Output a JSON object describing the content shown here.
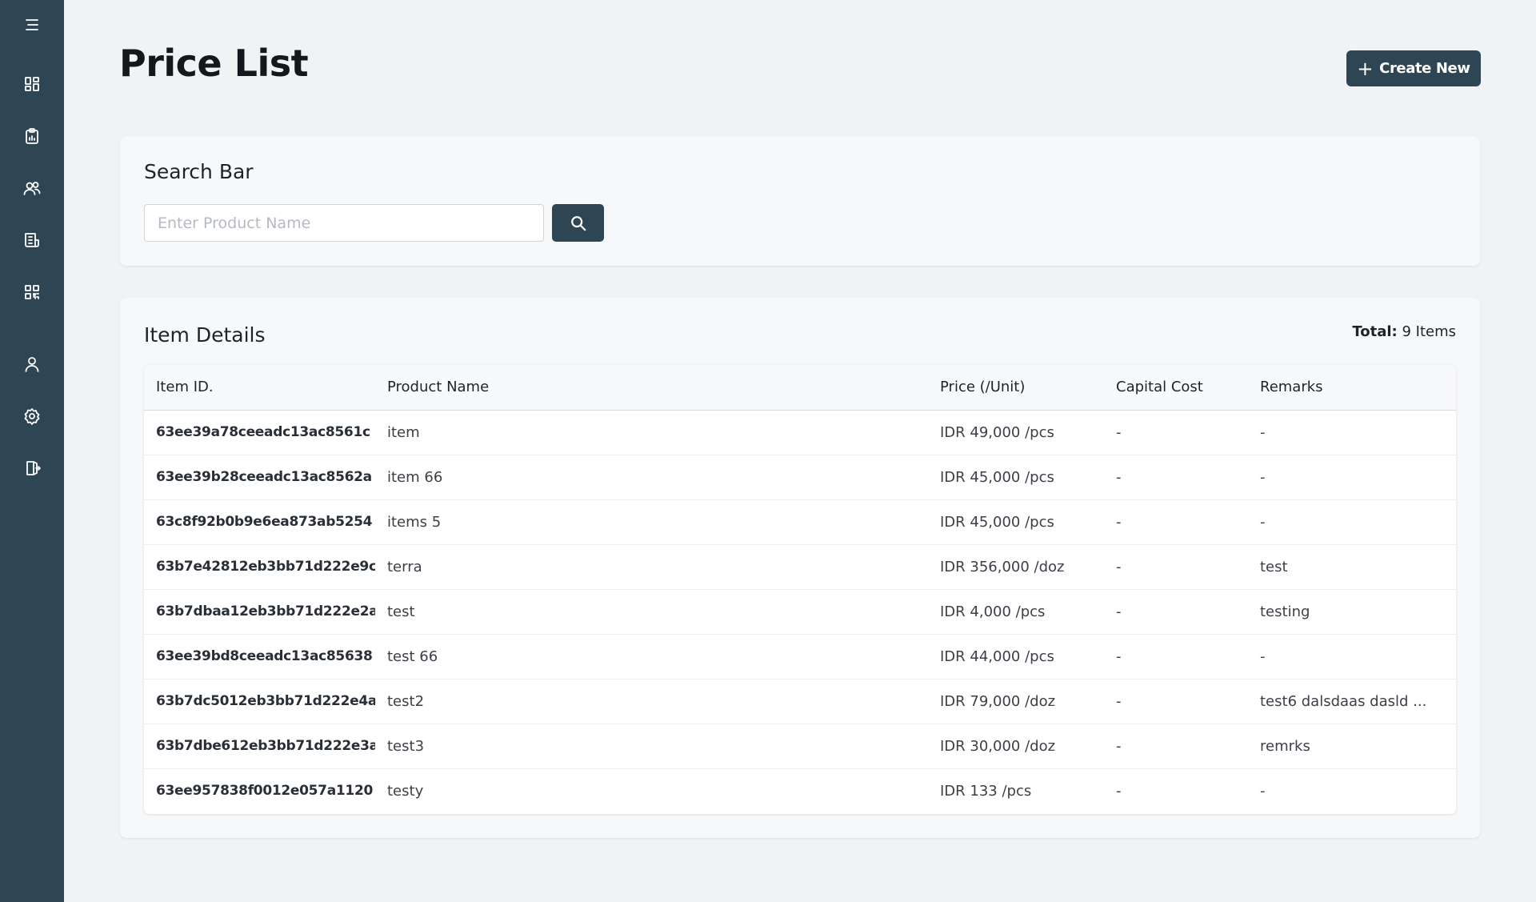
{
  "sidebar": {
    "items": [
      {
        "name": "menu-icon"
      },
      {
        "name": "dashboard-icon"
      },
      {
        "name": "clipboard-report-icon"
      },
      {
        "name": "users-icon"
      },
      {
        "name": "document-list-icon"
      },
      {
        "name": "qr-code-icon"
      },
      {
        "name": "user-profile-icon"
      },
      {
        "name": "settings-icon"
      },
      {
        "name": "logout-icon"
      }
    ]
  },
  "header": {
    "title": "Price List",
    "create_button_label": "Create New",
    "create_button_icon": "plus-icon"
  },
  "search": {
    "title": "Search Bar",
    "placeholder": "Enter Product Name",
    "value": "",
    "button_icon": "search-icon"
  },
  "items": {
    "title": "Item Details",
    "total_label": "Total:",
    "total_value": "9 Items",
    "columns": [
      "Item ID.",
      "Product Name",
      "Price (/Unit)",
      "Capital Cost",
      "Remarks"
    ],
    "rows": [
      {
        "id": "63ee39a78ceeadc13ac8561c",
        "name": "item",
        "price": "IDR 49,000 /pcs",
        "capital": "-",
        "remarks": "-"
      },
      {
        "id": "63ee39b28ceeadc13ac8562a",
        "name": "item 66",
        "price": "IDR 45,000 /pcs",
        "capital": "-",
        "remarks": "-"
      },
      {
        "id": "63c8f92b0b9e6ea873ab5254",
        "name": "items 5",
        "price": "IDR 45,000 /pcs",
        "capital": "-",
        "remarks": "-"
      },
      {
        "id": "63b7e42812eb3bb71d222e9c",
        "name": "terra",
        "price": "IDR 356,000 /doz",
        "capital": "-",
        "remarks": "test"
      },
      {
        "id": "63b7dbaa12eb3bb71d222e2a",
        "name": "test",
        "price": "IDR 4,000 /pcs",
        "capital": "-",
        "remarks": "testing"
      },
      {
        "id": "63ee39bd8ceeadc13ac85638",
        "name": "test 66",
        "price": "IDR 44,000 /pcs",
        "capital": "-",
        "remarks": "-"
      },
      {
        "id": "63b7dc5012eb3bb71d222e4a",
        "name": "test2",
        "price": "IDR 79,000 /doz",
        "capital": "-",
        "remarks": "test6 dalsdaas dasld ..."
      },
      {
        "id": "63b7dbe612eb3bb71d222e3a",
        "name": "test3",
        "price": "IDR 30,000 /doz",
        "capital": "-",
        "remarks": "remrks"
      },
      {
        "id": "63ee957838f0012e057a1120",
        "name": "testy",
        "price": "IDR 133 /pcs",
        "capital": "-",
        "remarks": "-"
      }
    ]
  },
  "colors": {
    "sidebar_bg": "#2e4653",
    "accent": "#2e4653",
    "page_bg": "#f0f2f4",
    "card_bg": "#f7f8fa"
  }
}
